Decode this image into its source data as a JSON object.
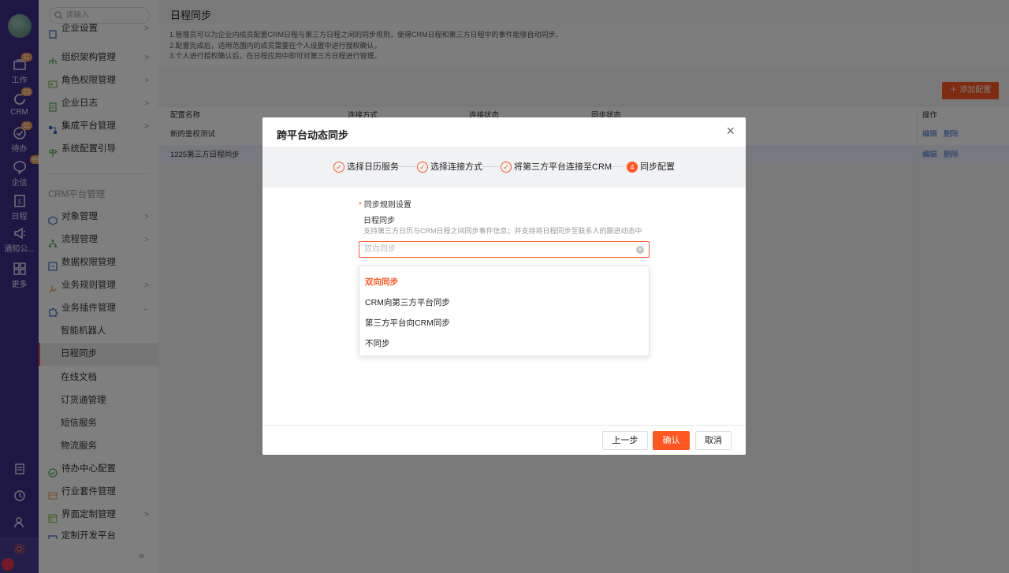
{
  "rail": {
    "items": [
      {
        "label": "工作",
        "badge": "11"
      },
      {
        "label": "CRM",
        "badge": "22"
      },
      {
        "label": "待办",
        "badge": "11"
      },
      {
        "label": "企信",
        "badge": "99+"
      },
      {
        "label": "日程",
        "badge": ""
      },
      {
        "label": "通知公...",
        "badge": ""
      },
      {
        "label": "更多",
        "badge": ""
      }
    ],
    "calendar_day": "5"
  },
  "sidebar": {
    "search_placeholder": "请输入",
    "items_top": [
      {
        "label": "企业设置"
      },
      {
        "label": "组织架构管理"
      },
      {
        "label": "角色权限管理"
      },
      {
        "label": "企业日志"
      },
      {
        "label": "集成平台管理"
      },
      {
        "label": "系统配置引导"
      }
    ],
    "group_title": "CRM平台管理",
    "items_crm": [
      {
        "label": "对象管理"
      },
      {
        "label": "流程管理"
      },
      {
        "label": "数据权限管理"
      },
      {
        "label": "业务规则管理"
      },
      {
        "label": "业务插件管理"
      }
    ],
    "sub_items": [
      {
        "label": "智能机器人"
      },
      {
        "label": "日程同步"
      },
      {
        "label": "在线文档"
      },
      {
        "label": "订货通管理"
      },
      {
        "label": "短信服务"
      },
      {
        "label": "物流服务"
      }
    ],
    "items_bottom": [
      {
        "label": "待办中心配置"
      },
      {
        "label": "行业套件管理"
      },
      {
        "label": "界面定制管理"
      },
      {
        "label": "定制开发平台"
      }
    ],
    "collapse": "«"
  },
  "main": {
    "title": "日程同步",
    "notice": [
      "1.管理员可以为企业内成员配置CRM日程与第三方日程之间的同步规则，使得CRM日程和第三方日程中的事件能够自动同步。",
      "2.配置完成后，适用范围内的成员需要在个人设置中进行授权确认。",
      "3.个人进行授权确认后，在日程应用中即可对第三方日程进行管理。"
    ],
    "add_button": "添加配置",
    "columns": [
      "配置名称",
      "连接方式",
      "连接状态",
      "同步状态",
      "操作"
    ],
    "rows": [
      {
        "name": "新的鉴权测试",
        "edit": "编辑",
        "delete": "删除"
      },
      {
        "name": "1225第三方日程同步",
        "edit": "编辑",
        "delete": "删除"
      }
    ]
  },
  "modal": {
    "title": "跨平台动态同步",
    "close": "×",
    "steps": [
      {
        "label": "选择日历服务",
        "marker": "✓"
      },
      {
        "label": "选择连接方式",
        "marker": "✓"
      },
      {
        "label": "将第三方平台连接至CRM",
        "marker": "✓"
      },
      {
        "label": "同步配置",
        "marker": "4"
      }
    ],
    "field_label": "同步规则设置",
    "field_required": "*",
    "sub_title": "日程同步",
    "description": "支持第三方日历与CRM日程之间同步事件信息；并支持将日程同步至联系人的跟进动态中",
    "select_value": "双向同步",
    "options": [
      "双向同步",
      "CRM向第三方平台同步",
      "第三方平台向CRM同步",
      "不同步"
    ],
    "buttons": {
      "prev": "上一步",
      "confirm": "确认",
      "cancel": "取消"
    }
  },
  "colors": {
    "accent": "#ff5722",
    "rail": "#3f2f86",
    "link": "#3b6cd1"
  }
}
